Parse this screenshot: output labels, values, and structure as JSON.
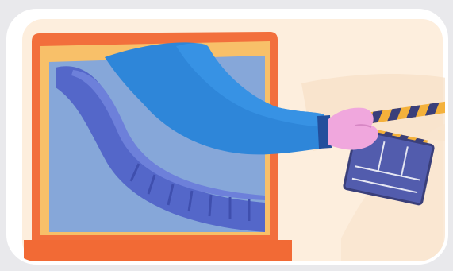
{
  "illustration": {
    "subject": "laptop-with-film-strip-and-clapperboard",
    "colors": {
      "card_background": "#ffffff",
      "panel_background": "#fdeedd",
      "laptop_frame": "#f26f3c",
      "laptop_inner": "#f8c069",
      "screen": "#86a7d9",
      "film_strip": "#5467c9",
      "arm": "#2e86d9",
      "hand": "#f0a7dd",
      "clapper_body": "#525cad",
      "clapper_stripe_dark": "#3a3f7a",
      "clapper_stripe_light": "#f4b13b",
      "base": "#f26a35"
    }
  }
}
